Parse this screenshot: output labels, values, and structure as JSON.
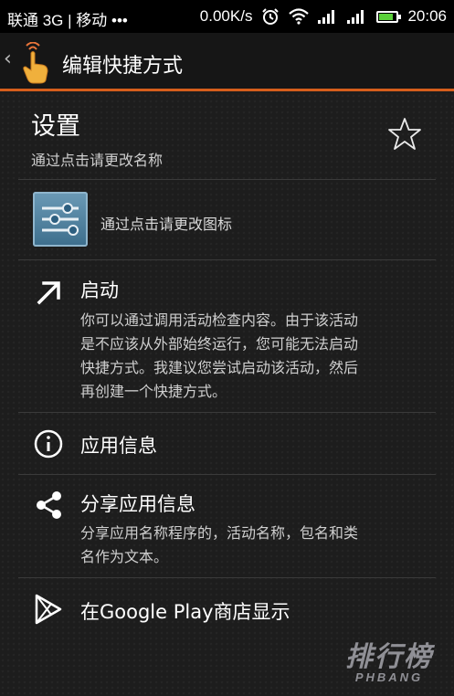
{
  "status_bar": {
    "carrier": "联通 3G | 移动 •••",
    "speed": "0.00K/s",
    "time": "20:06",
    "battery_level": 0.85,
    "battery_color": "#5ad13a",
    "icons": [
      "alarm-icon",
      "wifi-icon",
      "signal-icon",
      "signal-icon",
      "battery-icon"
    ]
  },
  "action_bar": {
    "title": "编辑快捷方式",
    "accent_color": "#d65e1c"
  },
  "shortcut": {
    "name": "设置",
    "name_hint": "通过点击请更改名称",
    "icon_hint": "通过点击请更改图标"
  },
  "items": [
    {
      "icon": "arrow-up-right-icon",
      "title": "启动",
      "description": "你可以通过调用活动检查内容。由于该活动是不应该从外部始终运行，您可能无法启动快捷方式。我建议您尝试启动该活动，然后再创建一个快捷方式。",
      "desc_lines": [
        "你可以通过调用活动检查内容。由于该活动",
        "是不应该从外部始终运行，您可能无法启动",
        "快捷方式。我建议您尝试启动该活动，然后",
        "再创建一个快捷方式。"
      ]
    },
    {
      "icon": "info-icon",
      "title": "应用信息"
    },
    {
      "icon": "share-icon",
      "title": "分享应用信息",
      "desc_lines": [
        "分享应用名称程序的，活动名称，包名和类",
        "名作为文本。"
      ]
    },
    {
      "icon": "play-store-icon",
      "title": "在Google Play商店显示"
    }
  ],
  "watermark": {
    "main": "排行榜",
    "sub": "PHBANG"
  }
}
